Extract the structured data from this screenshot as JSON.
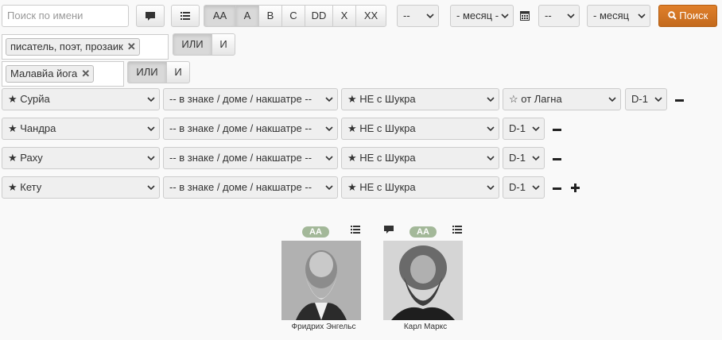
{
  "search": {
    "placeholder": "Поиск по имени",
    "button_label": "Поиск"
  },
  "rating_filter": [
    "AA",
    "A",
    "B",
    "C",
    "DD",
    "X",
    "XX"
  ],
  "date": {
    "day1": "--",
    "month1": "- месяц -",
    "day2": "--",
    "month2": "- месяц"
  },
  "tag_filters": [
    {
      "tag": "писатель, поэт, прозаик",
      "or_label": "ИЛИ",
      "and_label": "И"
    },
    {
      "tag": "Малавйа йога",
      "or_label": "ИЛИ",
      "and_label": "И"
    }
  ],
  "planet_rows": [
    {
      "planet": "★ Сурйа",
      "position": "-- в знаке / доме / накшатре --",
      "with": "★ НЕ с Шукра",
      "from": "☆ от Лагна",
      "chart": "D-1"
    },
    {
      "planet": "★ Чандра",
      "position": "-- в знаке / доме / накшатре --",
      "with": "★ НЕ с Шукра",
      "chart": "D-1"
    },
    {
      "planet": "★ Раху",
      "position": "-- в знаке / доме / накшатре --",
      "with": "★ НЕ с Шукра",
      "chart": "D-1"
    },
    {
      "planet": "★ Кету",
      "position": "-- в знаке / доме / накшатре --",
      "with": "★ НЕ с Шукра",
      "chart": "D-1"
    }
  ],
  "results": [
    {
      "name": "Фридрих Энгельс",
      "rating": "AA"
    },
    {
      "name": "Карл Маркс",
      "rating": "AA"
    }
  ],
  "colors": {
    "accent": "#d0742a",
    "badge": "#a3b899"
  }
}
